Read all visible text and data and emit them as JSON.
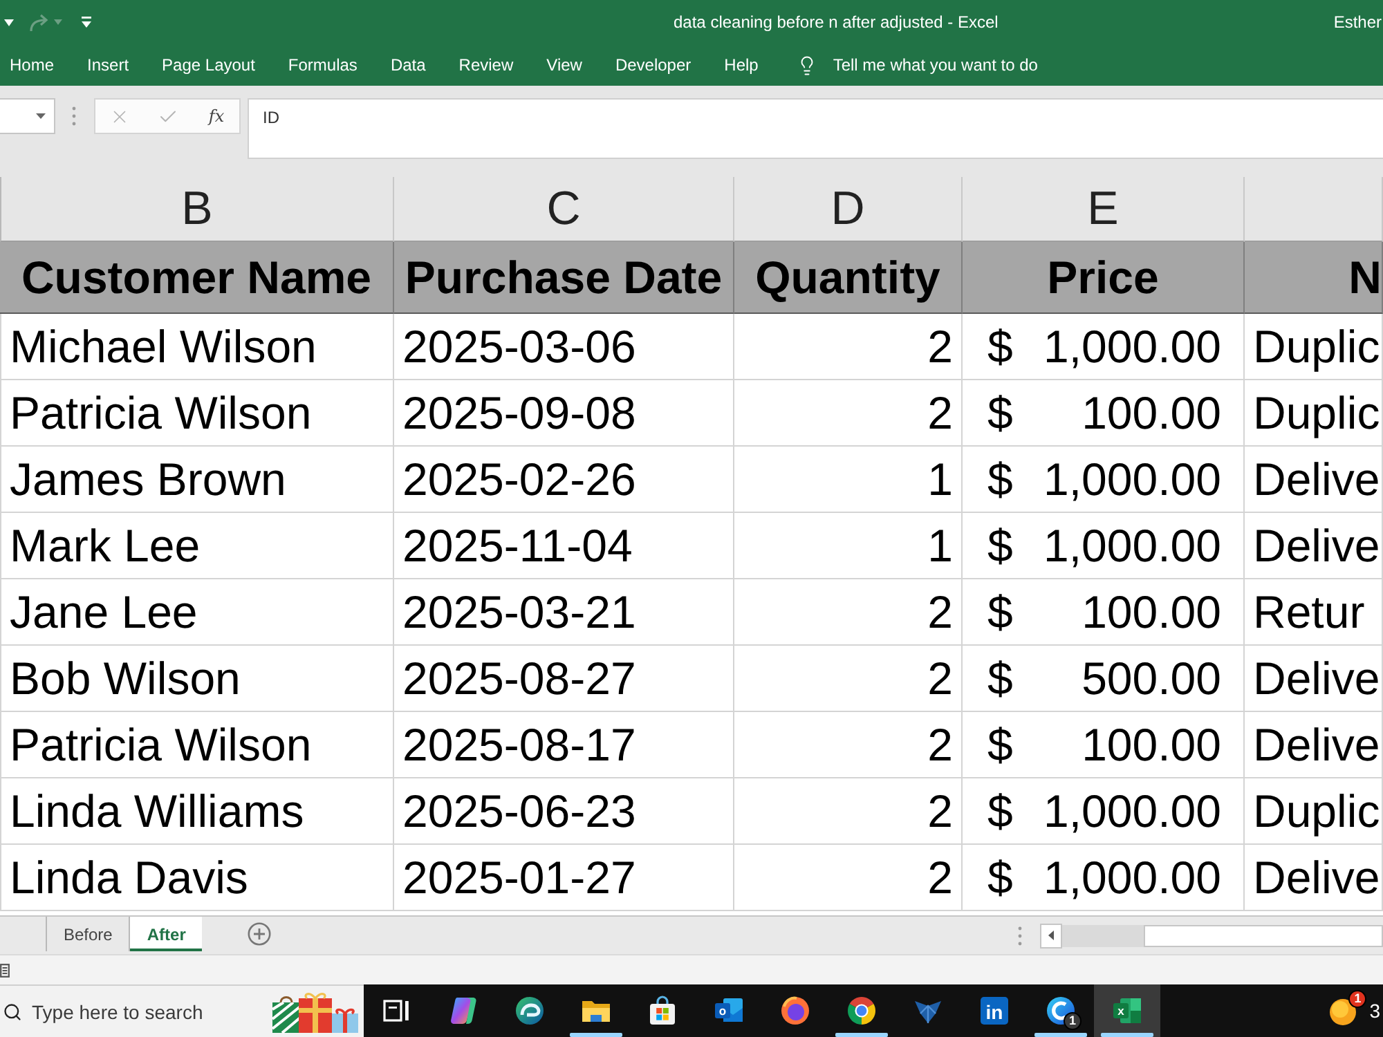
{
  "title_bar": {
    "quick_access": [
      {
        "kind": "undo_menu",
        "disabled": false
      },
      {
        "kind": "redo",
        "disabled": true
      },
      {
        "kind": "redo_menu",
        "disabled": true
      },
      {
        "kind": "customize",
        "disabled": false
      }
    ],
    "title": "data cleaning before n after adjusted - Excel",
    "user": "Esther"
  },
  "ribbon": {
    "tabs": [
      "Home",
      "Insert",
      "Page Layout",
      "Formulas",
      "Data",
      "Review",
      "View",
      "Developer",
      "Help"
    ],
    "tell_me": "Tell me what you want to do"
  },
  "formula_bar": {
    "cancel": {
      "disabled": true
    },
    "enter": {
      "disabled": true
    },
    "function_button": "fx",
    "value": "ID"
  },
  "sheet": {
    "columns": [
      {
        "letter": "B",
        "heading": "Customer Name",
        "kind": "text"
      },
      {
        "letter": "C",
        "heading": "Purchase Date",
        "kind": "text"
      },
      {
        "letter": "D",
        "heading": "Quantity",
        "kind": "number"
      },
      {
        "letter": "E",
        "heading": "Price",
        "kind": "currency"
      },
      {
        "heading": "N",
        "kind": "text"
      }
    ],
    "rows": [
      [
        "Michael Wilson",
        "2025-03-06",
        "2",
        {
          "symbol": "$",
          "amount": "1,000.00"
        },
        "Duplic"
      ],
      [
        "Patricia Wilson",
        "2025-09-08",
        "2",
        {
          "symbol": "$",
          "amount": "100.00"
        },
        "Duplic"
      ],
      [
        "James Brown",
        "2025-02-26",
        "1",
        {
          "symbol": "$",
          "amount": "1,000.00"
        },
        "Delive"
      ],
      [
        "Mark Lee",
        "2025-11-04",
        "1",
        {
          "symbol": "$",
          "amount": "1,000.00"
        },
        "Delive"
      ],
      [
        "Jane Lee",
        "2025-03-21",
        "2",
        {
          "symbol": "$",
          "amount": "100.00"
        },
        "Retur"
      ],
      [
        "Bob Wilson",
        "2025-08-27",
        "2",
        {
          "symbol": "$",
          "amount": "500.00"
        },
        "Delive"
      ],
      [
        "Patricia Wilson",
        "2025-08-17",
        "2",
        {
          "symbol": "$",
          "amount": "100.00"
        },
        "Delive"
      ],
      [
        "Linda Williams",
        "2025-06-23",
        "2",
        {
          "symbol": "$",
          "amount": "1,000.00"
        },
        "Duplic"
      ],
      [
        "Linda Davis",
        "2025-01-27",
        "2",
        {
          "symbol": "$",
          "amount": "1,000.00"
        },
        "Delive"
      ]
    ]
  },
  "sheet_tabs": [
    {
      "label": "Before",
      "selected": false
    },
    {
      "label": "After",
      "selected": true
    }
  ],
  "taskbar": {
    "search": {
      "placeholder": "Type here to search"
    },
    "apps": [
      {
        "kind": "task_view",
        "running": false,
        "active": false
      },
      {
        "kind": "assistant",
        "running": false,
        "active": false
      },
      {
        "kind": "swirl_browser",
        "running": false,
        "active": false
      },
      {
        "kind": "folder",
        "running": true,
        "active": false
      },
      {
        "kind": "store",
        "running": false,
        "active": false
      },
      {
        "kind": "mail",
        "glyph": "o",
        "running": false,
        "active": false
      },
      {
        "kind": "fox_browser",
        "running": false,
        "active": false
      },
      {
        "kind": "wheel_browser",
        "running": true,
        "active": false
      },
      {
        "kind": "bird",
        "running": false,
        "active": false
      },
      {
        "kind": "letters",
        "glyph": "in",
        "running": false,
        "active": false
      },
      {
        "kind": "chat",
        "badge": "1",
        "running": true,
        "active": false
      },
      {
        "kind": "spreadsheet",
        "glyph": "x",
        "running": true,
        "active": true
      }
    ],
    "tray": {
      "weather_badge": "1",
      "temperature": "3"
    }
  }
}
